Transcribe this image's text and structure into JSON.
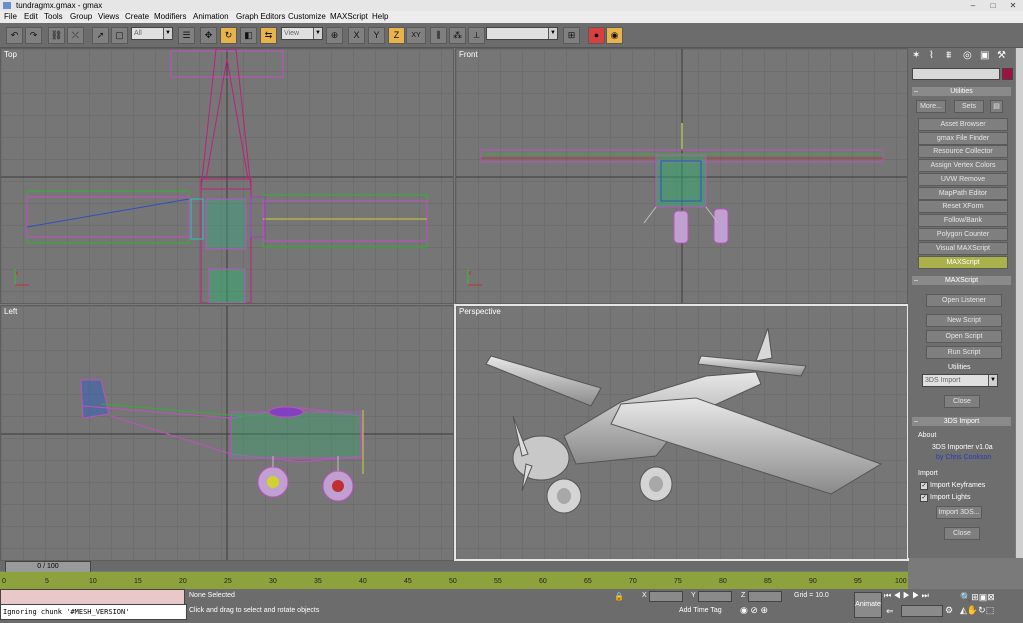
{
  "window": {
    "title": "tundragmx.gmax - gmax"
  },
  "menu": [
    "File",
    "Edit",
    "Tools",
    "Group",
    "Views",
    "Create",
    "Modifiers",
    "Animation",
    "Graph Editors",
    "Customize",
    "MAXScript",
    "Help"
  ],
  "toolbar": {
    "selection_filter": "All",
    "coord_system": "View",
    "named_selection": "",
    "axis_x": "X",
    "axis_y": "Y",
    "axis_z": "Z",
    "axis_xy": "XY"
  },
  "viewports": {
    "top": "Top",
    "front": "Front",
    "left": "Left",
    "perspective": "Perspective"
  },
  "panel": {
    "utilities_header": "Utilities",
    "more_label": "More...",
    "sets_label": "Sets",
    "utilities": [
      "Asset Browser",
      "gmax File Finder",
      "Resource Collector",
      "Assign Vertex Colors",
      "UVW Remove",
      "MapPath Editor",
      "Reset XForm",
      "Follow/Bank",
      "Polygon Counter",
      "Visual MAXScript",
      "MAXScript"
    ],
    "maxscript_header": "MAXScript",
    "maxscript_buttons": {
      "open_listener": "Open Listener",
      "new_script": "New Script",
      "open_script": "Open Script",
      "run_script": "Run Script"
    },
    "utilities_label": "Utilities",
    "utilities_select": "3DS Import",
    "close": "Close",
    "import_header": "3DS Import",
    "about_label": "About",
    "about_line1": "3DS Importer v1.0a",
    "about_line2": "by Chris Cookson",
    "import_label": "Import",
    "import_keyframes": "Import Keyframes",
    "import_lights": "Import Lights",
    "import_button": "Import 3DS...",
    "close2": "Close"
  },
  "timeline": {
    "frame": "0 / 100",
    "ticks": [
      "0",
      "5",
      "10",
      "15",
      "20",
      "25",
      "30",
      "35",
      "40",
      "45",
      "50",
      "55",
      "60",
      "65",
      "70",
      "75",
      "80",
      "85",
      "90",
      "95",
      "100"
    ]
  },
  "status": {
    "listener": "Ignoring chunk '#MESH_VERSION'",
    "selection": "None Selected",
    "prompt": "Click and drag to select and rotate objects",
    "x_label": "X",
    "y_label": "Y",
    "z_label": "Z",
    "grid": "Grid = 10.0",
    "add_time_tag": "Add Time Tag",
    "animate": "Animate"
  }
}
